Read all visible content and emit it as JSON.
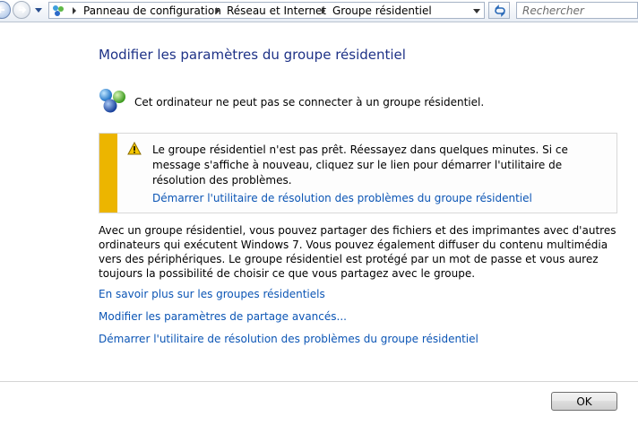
{
  "navbar": {
    "breadcrumbs": [
      "Panneau de configuration",
      "Réseau et Internet",
      "Groupe résidentiel"
    ],
    "search_placeholder": "Rechercher"
  },
  "main": {
    "title": "Modifier les paramètres du groupe résidentiel",
    "status_text": "Cet ordinateur ne peut pas se connecter à un groupe résidentiel.",
    "warning": {
      "message": "Le groupe résidentiel n'est pas prêt. Réessayez dans quelques minutes. Si ce message s'affiche à nouveau, cliquez sur le lien pour démarrer l'utilitaire de résolution des problèmes.",
      "link": "Démarrer l'utilitaire de résolution des problèmes du groupe résidentiel",
      "accent_color": "#ecb500"
    },
    "description": "Avec un groupe résidentiel, vous pouvez partager des fichiers et des imprimantes avec d'autres ordinateurs qui exécutent Windows 7. Vous pouvez également diffuser du contenu multimédia vers des périphériques. Le groupe résidentiel est protégé par un mot de passe et vous aurez toujours la possibilité de choisir ce que vous partagez avec le groupe.",
    "links": [
      "En savoir plus sur les groupes résidentiels",
      "Modifier les paramètres de partage avancés...",
      "Démarrer l'utilitaire de résolution des problèmes du groupe résidentiel"
    ],
    "link_color": "#0b55b5",
    "title_color": "#1e3287"
  },
  "footer": {
    "ok_label": "OK"
  }
}
